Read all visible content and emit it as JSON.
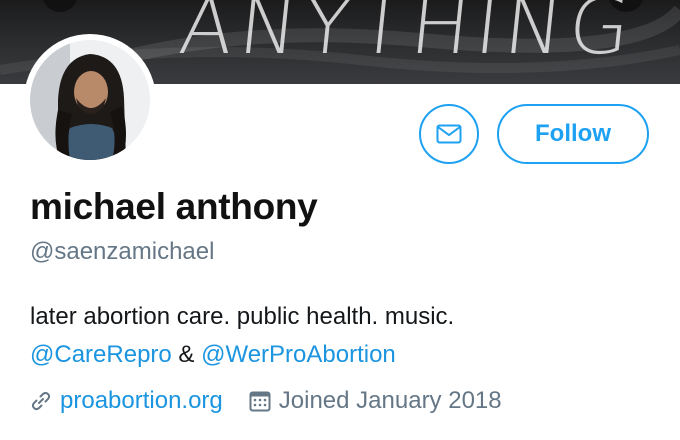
{
  "banner": {
    "text": "ANYTHING"
  },
  "profile": {
    "name": "michael anthony",
    "handle": "@saenzamichael",
    "bio_text": "later abortion care. public health. music.",
    "mention_1": "@CareRepro",
    "ampersand": "&",
    "mention_2": "@WerProAbortion",
    "website": "proabortion.org",
    "joined": "Joined January 2018"
  },
  "actions": {
    "follow_label": "Follow"
  },
  "icons": {
    "message": "envelope-icon",
    "link": "link-icon",
    "joined": "calendar-icon"
  },
  "colors": {
    "accent": "#1da1f2",
    "link": "#1b95e0",
    "muted": "#657786"
  }
}
